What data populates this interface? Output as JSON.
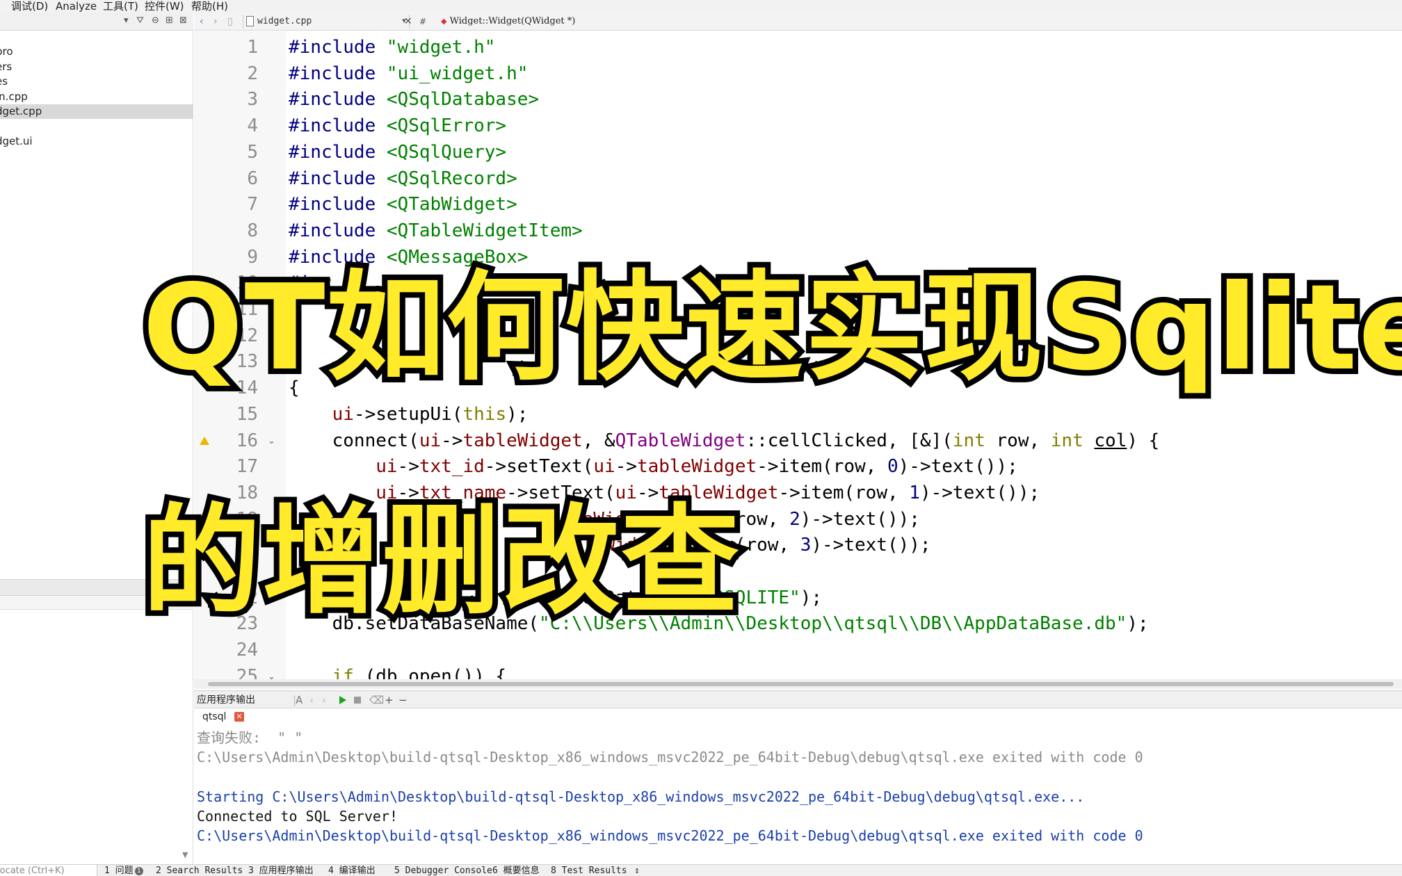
{
  "menubar": {
    "items": [
      "调试(D)",
      "Analyze",
      "工具(T)",
      "控件(W)",
      "帮助(H)"
    ]
  },
  "sidebar": {
    "toolbar_icons": [
      "filter-icon",
      "link-icon",
      "split-icon",
      "close-icon"
    ],
    "items": [
      {
        "label": "pro",
        "selected": false
      },
      {
        "label": "ers",
        "selected": false
      },
      {
        "label": "es",
        "selected": false
      },
      {
        "label": "in.cpp",
        "selected": false
      },
      {
        "label": "dget.cpp",
        "selected": true
      },
      {
        "label": ".",
        "selected": false
      },
      {
        "label": "dget.ui",
        "selected": false
      }
    ]
  },
  "editor": {
    "file_name": "widget.cpp",
    "symbol": "Widget::Widget(QWidget *)",
    "hash_symbol": "#",
    "lines": [
      {
        "n": "1",
        "parts": [
          {
            "t": "#include ",
            "c": "pp"
          },
          {
            "t": "\"widget.h\"",
            "c": "str"
          }
        ]
      },
      {
        "n": "2",
        "parts": [
          {
            "t": "#include ",
            "c": "pp"
          },
          {
            "t": "\"ui_widget.h\"",
            "c": "str"
          }
        ]
      },
      {
        "n": "3",
        "parts": [
          {
            "t": "#include ",
            "c": "pp"
          },
          {
            "t": "<QSqlDatabase>",
            "c": "str"
          }
        ]
      },
      {
        "n": "4",
        "parts": [
          {
            "t": "#include ",
            "c": "pp"
          },
          {
            "t": "<QSqlError>",
            "c": "str"
          }
        ]
      },
      {
        "n": "5",
        "parts": [
          {
            "t": "#include ",
            "c": "pp"
          },
          {
            "t": "<QSqlQuery>",
            "c": "str"
          }
        ]
      },
      {
        "n": "6",
        "parts": [
          {
            "t": "#include ",
            "c": "pp"
          },
          {
            "t": "<QSqlRecord>",
            "c": "str"
          }
        ]
      },
      {
        "n": "7",
        "parts": [
          {
            "t": "#include ",
            "c": "pp"
          },
          {
            "t": "<QTabWidget>",
            "c": "str"
          }
        ]
      },
      {
        "n": "8",
        "parts": [
          {
            "t": "#include ",
            "c": "pp"
          },
          {
            "t": "<QTableWidgetItem>",
            "c": "str"
          }
        ]
      },
      {
        "n": "9",
        "parts": [
          {
            "t": "#include ",
            "c": "pp"
          },
          {
            "t": "<QMessageBox>",
            "c": "str"
          }
        ]
      },
      {
        "n": "10",
        "parts": [
          {
            "t": "#inc",
            "c": "pp"
          }
        ]
      },
      {
        "n": "11",
        "parts": []
      },
      {
        "n": "12",
        "parts": []
      },
      {
        "n": "13",
        "parts": []
      },
      {
        "n": "14",
        "parts": [
          {
            "t": "{",
            "c": ""
          }
        ]
      },
      {
        "n": "15",
        "parts": [
          {
            "t": "    ",
            "c": ""
          },
          {
            "t": "ui",
            "c": "mem"
          },
          {
            "t": "->setupUi(",
            "c": ""
          },
          {
            "t": "this",
            "c": "kw"
          },
          {
            "t": ");",
            "c": ""
          }
        ]
      },
      {
        "n": "16",
        "fold": true,
        "warn": true,
        "parts": [
          {
            "t": "    connect(",
            "c": ""
          },
          {
            "t": "ui",
            "c": "mem"
          },
          {
            "t": "->",
            "c": ""
          },
          {
            "t": "tableWidget",
            "c": "mem"
          },
          {
            "t": ", &",
            "c": ""
          },
          {
            "t": "QTableWidget",
            "c": "cls"
          },
          {
            "t": "::cellClicked, [&](",
            "c": ""
          },
          {
            "t": "int",
            "c": "kw"
          },
          {
            "t": " row, ",
            "c": ""
          },
          {
            "t": "int",
            "c": "kw"
          },
          {
            "t": " ",
            "c": ""
          },
          {
            "t": "col",
            "c": "ul"
          },
          {
            "t": ") {",
            "c": ""
          }
        ]
      },
      {
        "n": "17",
        "parts": [
          {
            "t": "        ",
            "c": ""
          },
          {
            "t": "ui",
            "c": "mem"
          },
          {
            "t": "->",
            "c": ""
          },
          {
            "t": "txt_id",
            "c": "mem"
          },
          {
            "t": "->setText(",
            "c": ""
          },
          {
            "t": "ui",
            "c": "mem"
          },
          {
            "t": "->",
            "c": ""
          },
          {
            "t": "tableWidget",
            "c": "mem"
          },
          {
            "t": "->item(row, ",
            "c": ""
          },
          {
            "t": "0",
            "c": "num"
          },
          {
            "t": ")->text());",
            "c": ""
          }
        ]
      },
      {
        "n": "18",
        "parts": [
          {
            "t": "        ",
            "c": ""
          },
          {
            "t": "ui",
            "c": "mem"
          },
          {
            "t": "->",
            "c": ""
          },
          {
            "t": "txt_name",
            "c": "mem"
          },
          {
            "t": "->setText(",
            "c": ""
          },
          {
            "t": "ui",
            "c": "mem"
          },
          {
            "t": "->",
            "c": ""
          },
          {
            "t": "tableWidget",
            "c": "mem"
          },
          {
            "t": "->item(row, ",
            "c": ""
          },
          {
            "t": "1",
            "c": "num"
          },
          {
            "t": ")->text());",
            "c": ""
          }
        ]
      },
      {
        "n": "19",
        "parts": [
          {
            "t": "                          ",
            "c": ""
          },
          {
            "t": "leWidget",
            "c": "mem"
          },
          {
            "t": "->item(row, ",
            "c": ""
          },
          {
            "t": "2",
            "c": "num"
          },
          {
            "t": ")->text());",
            "c": ""
          }
        ]
      },
      {
        "n": "20",
        "parts": [
          {
            "t": "                          ",
            "c": ""
          },
          {
            "t": "bleWidget",
            "c": "mem"
          },
          {
            "t": "->item(row, ",
            "c": ""
          },
          {
            "t": "3",
            "c": "num"
          },
          {
            "t": ")->text());",
            "c": ""
          }
        ]
      },
      {
        "n": "21",
        "parts": []
      },
      {
        "n": "22",
        "parts": [
          {
            "t": "                          addDatabase(",
            "c": ""
          },
          {
            "t": "\"QSQLITE\"",
            "c": "str"
          },
          {
            "t": ");",
            "c": ""
          }
        ]
      },
      {
        "n": "23",
        "parts": [
          {
            "t": "    db.setDataBaseName(",
            "c": ""
          },
          {
            "t": "\"C:\\\\Users\\\\Admin\\\\Desktop\\\\qtsql\\\\DB\\\\AppDataBase.db\"",
            "c": "str"
          },
          {
            "t": ");",
            "c": ""
          }
        ]
      },
      {
        "n": "24",
        "parts": []
      },
      {
        "n": "25",
        "fold": true,
        "parts": [
          {
            "t": "    ",
            "c": ""
          },
          {
            "t": "if",
            "c": "kw"
          },
          {
            "t": " (db.open()) {",
            "c": ""
          }
        ]
      }
    ]
  },
  "output": {
    "title": "应用程序输出",
    "tab_label": "qtsql",
    "lines": [
      {
        "text": "查询失败:  \" \"",
        "style": "gray"
      },
      {
        "text": "C:\\Users\\Admin\\Desktop\\build-qtsql-Desktop_x86_windows_msvc2022_pe_64bit-Debug\\debug\\qtsql.exe exited with code 0",
        "style": "gray"
      },
      {
        "text": "",
        "style": "gray"
      },
      {
        "text": "Starting C:\\Users\\Admin\\Desktop\\build-qtsql-Desktop_x86_windows_msvc2022_pe_64bit-Debug\\debug\\qtsql.exe...",
        "style": "blue"
      },
      {
        "text": "Connected to SQL Server!",
        "style": "black"
      },
      {
        "text": "C:\\Users\\Admin\\Desktop\\build-qtsql-Desktop_x86_windows_msvc2022_pe_64bit-Debug\\debug\\qtsql.exe exited with code 0",
        "style": "blue"
      }
    ]
  },
  "statusbar": {
    "locator_placeholder": "locate (Ctrl+K)",
    "tabs": [
      {
        "label": "1 问题",
        "badge": "1"
      },
      {
        "label": "2 Search Results"
      },
      {
        "label": "3 应用程序输出"
      },
      {
        "label": "4 编译输出"
      },
      {
        "label": "5 Debugger Console"
      },
      {
        "label": "6 概要信息"
      },
      {
        "label": "8 Test Results"
      }
    ],
    "more_icon": "updown-arrow-icon"
  },
  "overlay": {
    "line1": "QT如何快速实现Sqlite",
    "line2": "的增删改查",
    "fill_color": "#ffeb2a",
    "stroke_color": "#000000"
  }
}
